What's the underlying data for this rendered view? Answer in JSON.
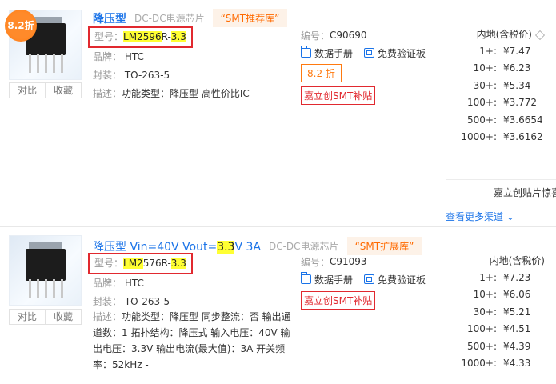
{
  "listings": [
    {
      "discount_badge": "8.2折",
      "thumb_buttons": [
        "对比",
        "收藏"
      ],
      "title": "降压型",
      "category_tag": "DC-DC电源芯片",
      "smt_tag": "“SMT推荐库”",
      "part_label": "型号：",
      "part_hl1": "LM2596",
      "part_mid": "R-",
      "part_hl2": "3.3",
      "brand_label": "品牌：",
      "brand": "HTC",
      "package_label": "封装：",
      "package": "TO-263-5",
      "desc_label": "描述：",
      "desc": "功能类型：降压型 高性价比IC",
      "code_label": "编号：",
      "code": "C90690",
      "datasheet": "数据手册",
      "eval_board": "免费验证板",
      "discount_pill": "8.2 折",
      "smt_subsidy": "嘉立创SMT补贴",
      "price_header": "内地(含税价)",
      "prices": [
        {
          "qty": "1+:",
          "amt": "¥7.47"
        },
        {
          "qty": "10+:",
          "amt": "¥6.23"
        },
        {
          "qty": "30+:",
          "amt": "¥5.34"
        },
        {
          "qty": "100+:",
          "amt": "¥3.772"
        },
        {
          "qty": "500+:",
          "amt": "¥3.6654"
        },
        {
          "qty": "1000+:",
          "amt": "¥3.6162"
        }
      ],
      "truncated": "嘉立创贴片惊喜",
      "more_channels": "查看更多渠道"
    },
    {
      "thumb_buttons": [
        "对比",
        "收藏"
      ],
      "title_pre": "降压型 Vin=40V Vout=",
      "title_hl": "3.3",
      "title_post": "V 3A",
      "category_tag": "DC-DC电源芯片",
      "smt_tag": "“SMT扩展库”",
      "part_label": "型号：",
      "part_hl1": "LM2",
      "part_mid": "576R-",
      "part_hl2": "3.3",
      "brand_label": "品牌：",
      "brand": "HTC",
      "package_label": "封装：",
      "package": "TO-263-5",
      "desc_label": "描述：",
      "desc": "功能类型：降压型 同步整流：否 输出通道数：1 拓扑结构：降压式 输入电压：40V 输出电压：3.3V 输出电流(最大值)：3A 开关频率：52kHz -",
      "code_label": "编号：",
      "code": "C91093",
      "datasheet": "数据手册",
      "eval_board": "免费验证板",
      "smt_subsidy": "嘉立创SMT补贴",
      "price_header": "内地(含税价)",
      "prices": [
        {
          "qty": "1+:",
          "amt": "¥7.23"
        },
        {
          "qty": "10+:",
          "amt": "¥6.06"
        },
        {
          "qty": "30+:",
          "amt": "¥5.21"
        },
        {
          "qty": "100+:",
          "amt": "¥4.51"
        },
        {
          "qty": "500+:",
          "amt": "¥4.39"
        },
        {
          "qty": "1000+:",
          "amt": "¥4.33"
        }
      ]
    }
  ],
  "colors": {
    "link": "#1a73e8",
    "highlight": "#ffff33",
    "red": "#e1292f",
    "orange": "#ff7a10"
  }
}
